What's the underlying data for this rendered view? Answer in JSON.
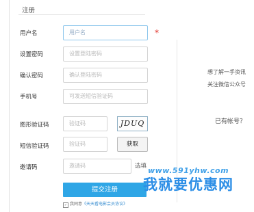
{
  "form": {
    "title": "注册",
    "fields": {
      "username": {
        "label": "用户名",
        "placeholder": "用户名",
        "required_mark": "*"
      },
      "password": {
        "label": "设置密码",
        "placeholder": "设置登陆密码"
      },
      "confirm": {
        "label": "确认密码",
        "placeholder": "确认登陆密码"
      },
      "phone": {
        "label": "手机号",
        "placeholder": "可发送短信验证码"
      },
      "captcha": {
        "label": "图形验证码",
        "placeholder": "验证码",
        "image_text": "JDUQ"
      },
      "sms": {
        "label": "短信验证码",
        "placeholder": "验证码",
        "button": "获取"
      },
      "invite": {
        "label": "邀请码",
        "placeholder": "邀请码",
        "optional": "选填"
      }
    },
    "submit_label": "提交注册",
    "agree": {
      "prefix": "我同意",
      "link": "《天天看电影会员协议》"
    }
  },
  "side": {
    "line1": "想了解一手资讯",
    "line2": "关注微信公众号",
    "line3": "已有帐号？"
  },
  "watermark": {
    "url": "www.591yhw.com",
    "text": "我就要优惠网"
  },
  "colors": {
    "accent": "#2fa6e6",
    "required": "#e2322a",
    "watermark": "#2c8ee6"
  },
  "icons": [
    "checkbox-icon"
  ]
}
